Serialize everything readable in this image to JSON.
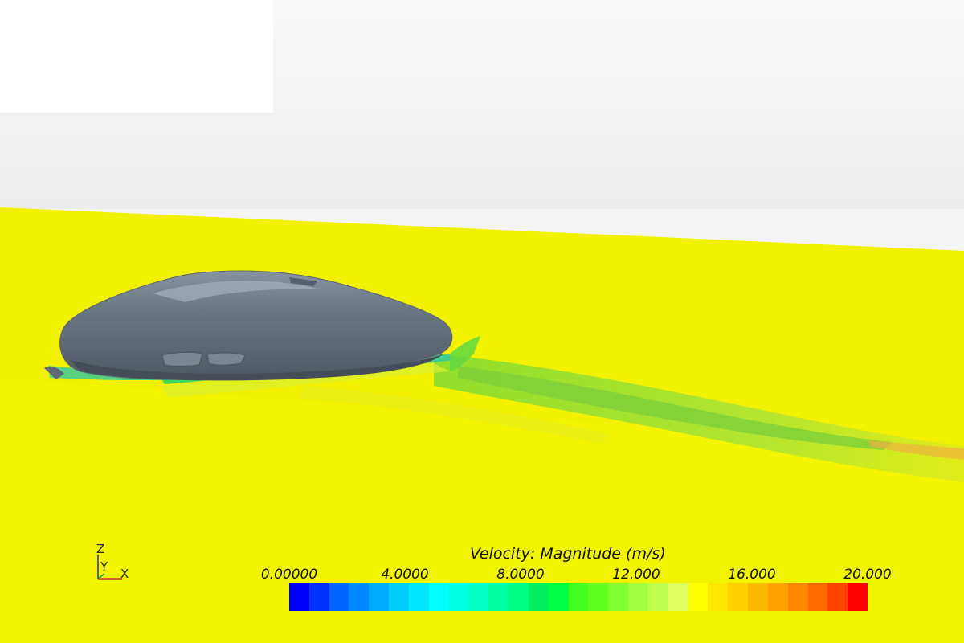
{
  "legend": {
    "title": "Velocity: Magnitude (m/s)",
    "ticks": [
      "0.00000",
      "4.0000",
      "8.0000",
      "12.000",
      "16.000",
      "20.000"
    ],
    "range": [
      0,
      20
    ],
    "colors": [
      "#0000ff",
      "#0033ff",
      "#0066ff",
      "#0088ff",
      "#00aaff",
      "#00ccff",
      "#00e6ff",
      "#00ffff",
      "#00ffe0",
      "#00ffc0",
      "#00ffa0",
      "#00ff80",
      "#00f060",
      "#00ff40",
      "#40ff20",
      "#60ff20",
      "#80ff30",
      "#a0ff40",
      "#c0ff50",
      "#e0ff60",
      "#ffff00",
      "#ffe600",
      "#ffd000",
      "#ffb800",
      "#ffa000",
      "#ff8800",
      "#ff6a00",
      "#ff4400",
      "#ff0000"
    ]
  },
  "axes": {
    "z": "Z",
    "y": "Y",
    "x": "X"
  },
  "colors": {
    "background": "#f4f4f4",
    "ground": "#f2f200",
    "body": "#6f7a85",
    "body_highlight": "#9aa6b1",
    "wake": "#8fd93a"
  }
}
